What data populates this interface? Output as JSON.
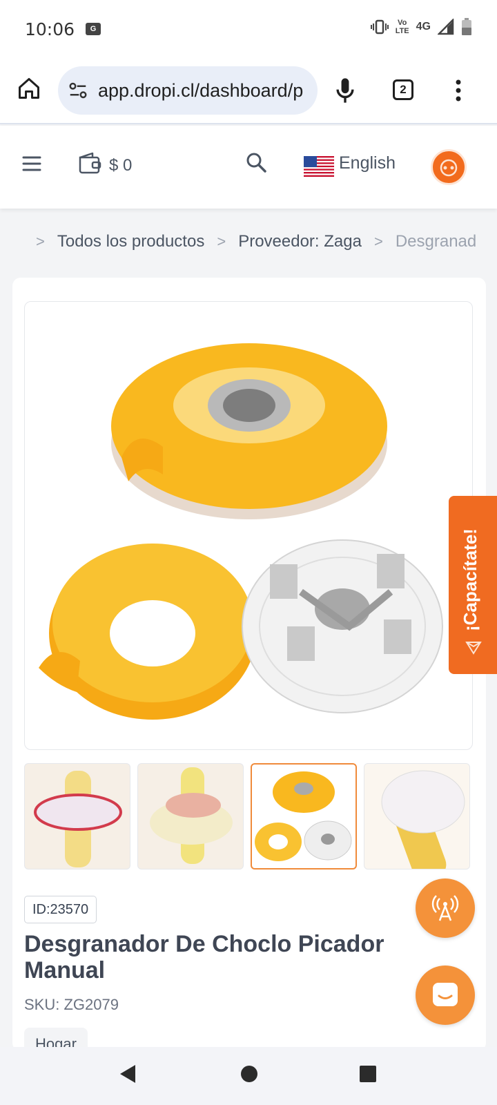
{
  "status": {
    "time": "10:06",
    "volte_top": "Vo",
    "volte_bottom": "LTE",
    "network": "4G"
  },
  "browser": {
    "url": "app.dropi.cl/dashboard/p",
    "tab_count": "2"
  },
  "header": {
    "wallet_amount": "$ 0",
    "language": "English"
  },
  "breadcrumb": {
    "items": [
      "Todos los productos",
      "Proveedor: Zaga",
      "Desgranador De Choclo Picador Manual"
    ]
  },
  "product": {
    "id_label": "ID:23570",
    "title": "Desgranador De Choclo Picador Manual",
    "sku": "SKU: ZG2079",
    "category": "Hogar"
  },
  "training_tab": {
    "label": "¡Capacítate!"
  },
  "colors": {
    "accent": "#f06b21",
    "fab": "#f4923a",
    "product_yellow": "#f9b81f"
  },
  "icons": {
    "home": "home-icon",
    "menu": "hamburger-menu-icon",
    "wallet": "wallet-icon",
    "search": "search-icon",
    "mic": "microphone-icon",
    "more": "more-vert-icon",
    "broadcast": "broadcast-icon",
    "chat": "chat-icon"
  }
}
